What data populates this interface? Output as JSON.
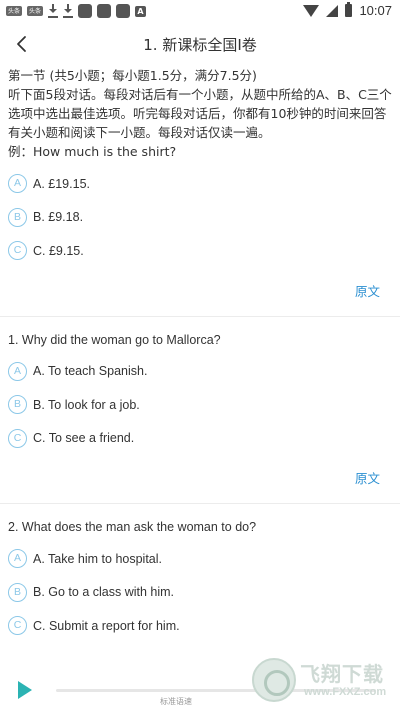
{
  "status_bar": {
    "badge1": "头条",
    "badge2": "头条",
    "a_icon": "A",
    "time": "10:07"
  },
  "header": {
    "title": "1. 新课标全国I卷"
  },
  "section": {
    "heading": "第一节 (共5小题；每小题1.5分，满分7.5分)",
    "instructions": "听下面5段对话。每段对话后有一个小题，从题中所给的A、B、C三个选项中选出最佳选项。听完每段对话后，你都有10秒钟的时间来回答有关小题和阅读下一小题。每段对话仅读一遍。",
    "example_question": "例：How much is the shirt?"
  },
  "example_options": [
    {
      "letter": "A",
      "text": "A. £19.15."
    },
    {
      "letter": "B",
      "text": "B. £9.18."
    },
    {
      "letter": "C",
      "text": "C. £9.15."
    }
  ],
  "original_label": "原文",
  "questions": [
    {
      "title": "1. Why did the woman go to Mallorca?",
      "options": [
        {
          "letter": "A",
          "text": "A. To teach Spanish."
        },
        {
          "letter": "B",
          "text": "B. To look for a job."
        },
        {
          "letter": "C",
          "text": "C. To see a friend."
        }
      ]
    },
    {
      "title": "2. What does the man ask the woman to do?",
      "options": [
        {
          "letter": "A",
          "text": "A. Take him to hospital."
        },
        {
          "letter": "B",
          "text": "B. Go to a class with him."
        },
        {
          "letter": "C",
          "text": "C. Submit a report for him."
        }
      ]
    }
  ],
  "player": {
    "speed_label": "标准语速"
  },
  "watermark": {
    "text": "飞翔下载",
    "url": "www.FXXZ.com"
  },
  "colors": {
    "accent_blue": "#2b8fd1",
    "badge_outline": "#8cc8e8",
    "play_teal": "#2bb3b3"
  }
}
